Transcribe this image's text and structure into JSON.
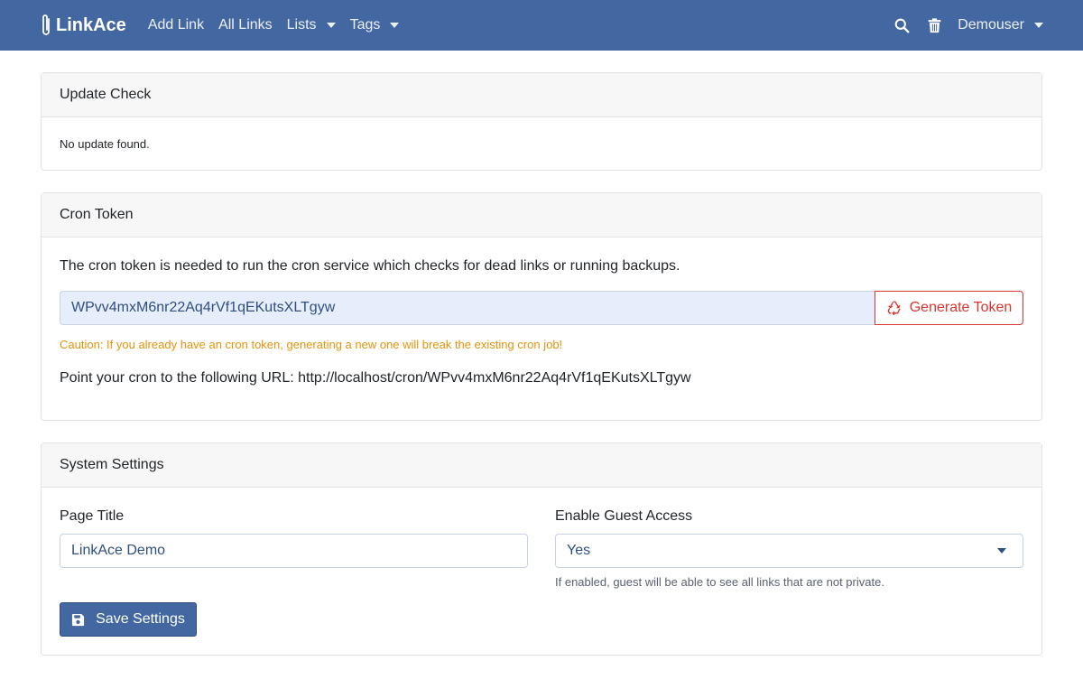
{
  "nav": {
    "brand": "LinkAce",
    "links": [
      {
        "label": "Add Link"
      },
      {
        "label": "All Links"
      },
      {
        "label": "Lists"
      },
      {
        "label": "Tags"
      }
    ],
    "user": "Demouser"
  },
  "update_check": {
    "title": "Update Check",
    "message": "No update found."
  },
  "cron_token": {
    "title": "Cron Token",
    "description": "The cron token is needed to run the cron service which checks for dead links or running backups.",
    "token": "WPvv4mxM6nr22Aq4rVf1qEKutsXLTgyw",
    "generate_label": "Generate Token",
    "caution": "Caution: If you already have an cron token, generating a new one will break the existing cron job!",
    "url_text": "Point your cron to the following URL: http://localhost/cron/WPvv4mxM6nr22Aq4rVf1qEKutsXLTgyw"
  },
  "system_settings": {
    "title": "System Settings",
    "page_title_label": "Page Title",
    "page_title_value": "LinkAce Demo",
    "guest_access_label": "Enable Guest Access",
    "guest_access_value": "Yes",
    "guest_access_help": "If enabled, guest will be able to see all links that are not private.",
    "save_label": "Save Settings"
  },
  "colors": {
    "navbar": "#4367a1",
    "danger": "#d9362f",
    "warning": "#e8930c",
    "primary": "#4367a1"
  },
  "icons": {
    "brand": "paperclip-icon",
    "search": "search-icon",
    "trash": "trash-icon",
    "generate": "recycle-icon",
    "save": "save-icon"
  }
}
